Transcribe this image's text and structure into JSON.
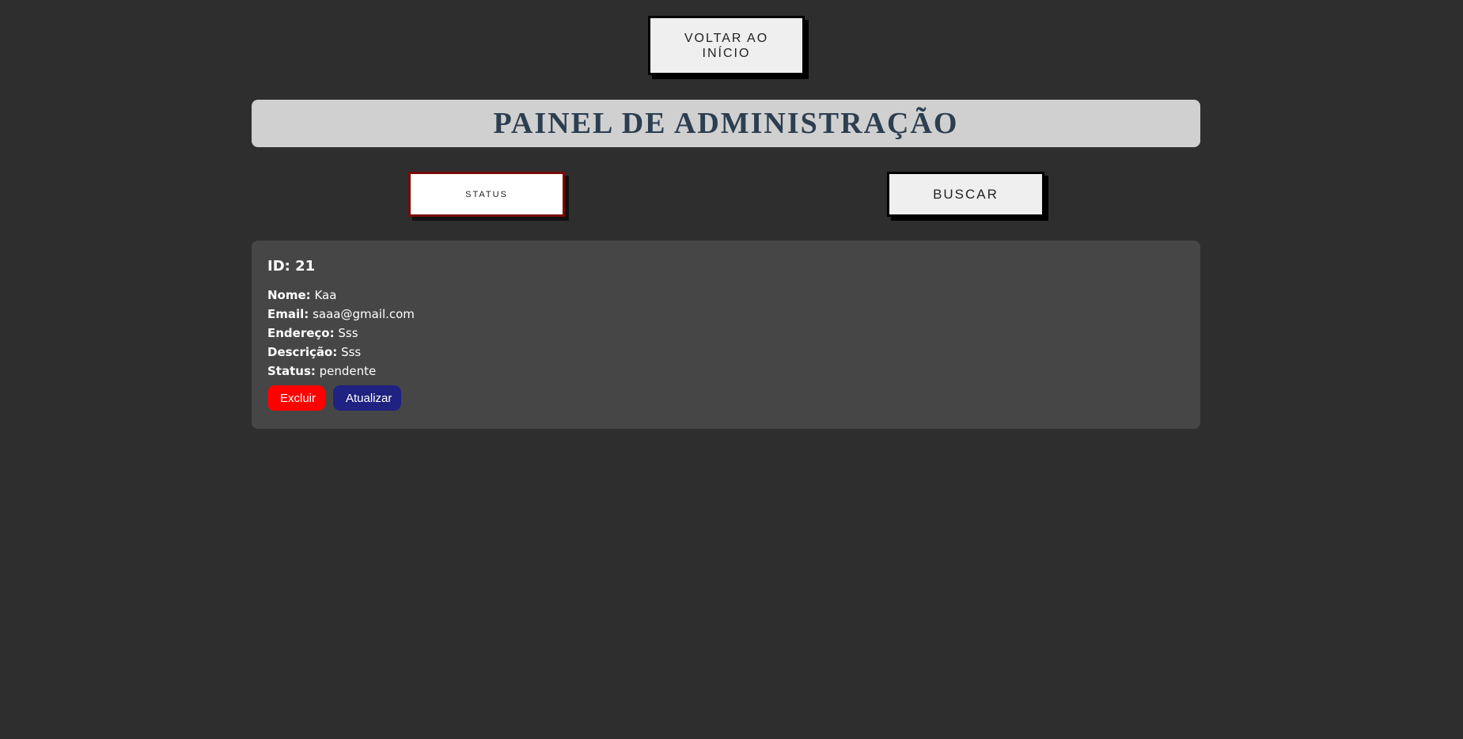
{
  "nav": {
    "back_label": "VOLTAR AO INÍCIO"
  },
  "header": {
    "title": "PAINEL DE ADMINISTRAÇÃO"
  },
  "toolbar": {
    "status_label": "STATUS",
    "search_label": "BUSCAR"
  },
  "record": {
    "id_label": "ID: 21",
    "fields": [
      {
        "label": "Nome:",
        "value": "Kaa"
      },
      {
        "label": "Email:",
        "value": "saaa@gmail.com"
      },
      {
        "label": "Endereço:",
        "value": "Sss"
      },
      {
        "label": "Descrição:",
        "value": "Sss"
      },
      {
        "label": "Status:",
        "value": "pendente"
      }
    ],
    "delete_label": "Excluir",
    "update_label": "Atualizar"
  },
  "colors": {
    "background": "#2e2e2e",
    "delete": "#ff0000",
    "update": "#1f2280",
    "title": "#2c3e50"
  }
}
